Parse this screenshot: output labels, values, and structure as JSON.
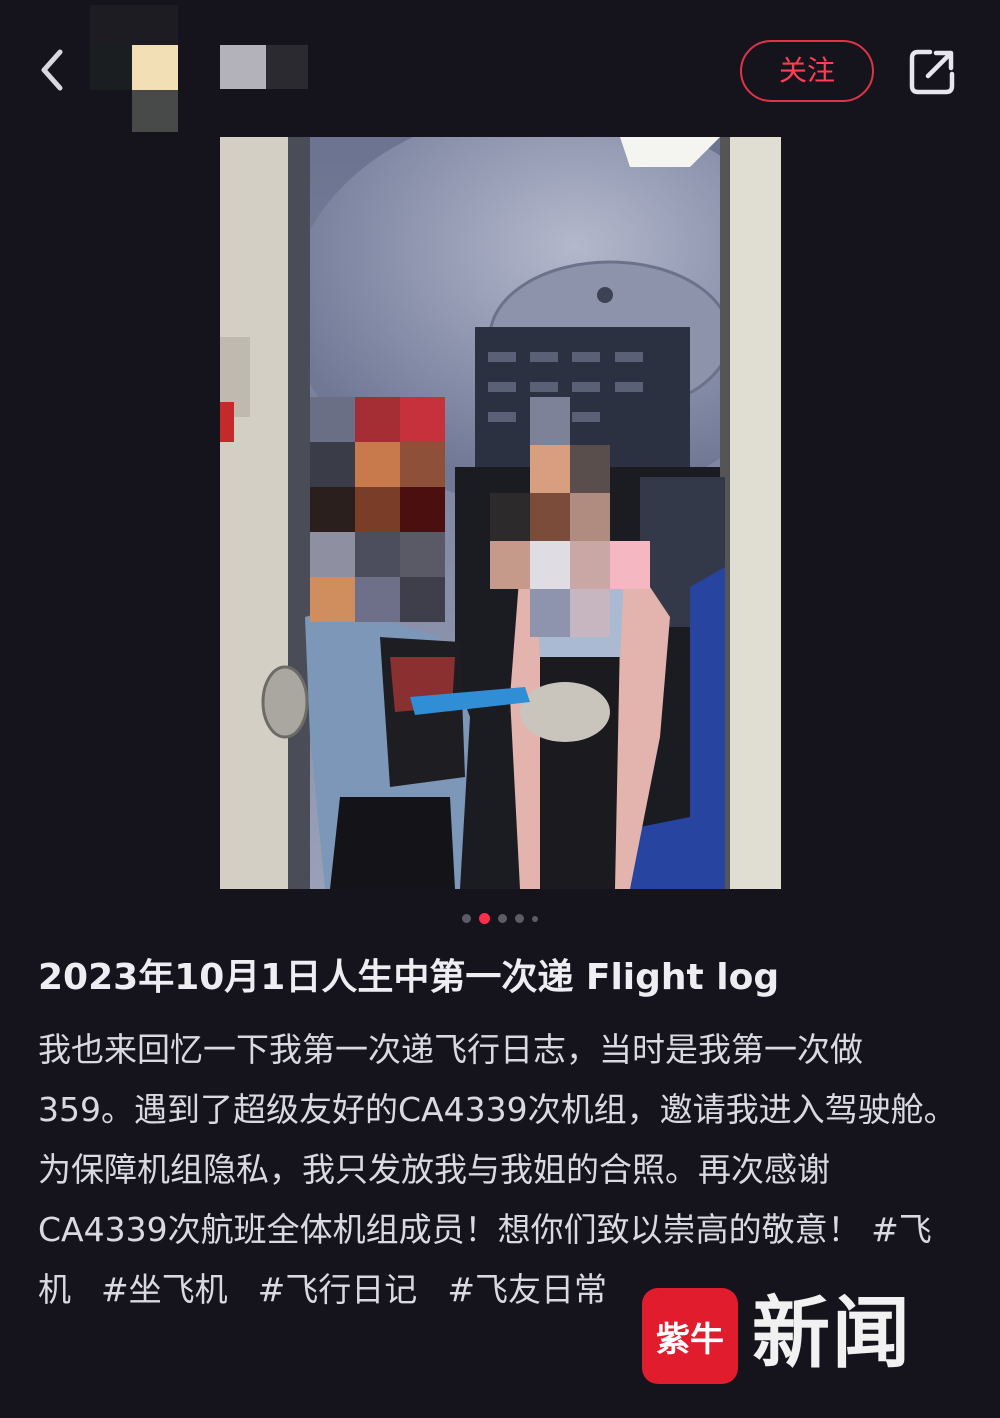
{
  "header": {
    "follow_label": "关注"
  },
  "icons": {
    "back": "chevron-left-icon",
    "share": "share-external-icon"
  },
  "gallery": {
    "total": 5,
    "active_index": 1
  },
  "post": {
    "title": "2023年10月1日人生中第一次递 Flight log",
    "body": "我也来回忆一下我第一次递飞行日志，当时是我第一次做359。遇到了超级友好的CA4339次机组，邀请我进入驾驶舱。为保障机组隐私，我只发放我与我姐的合照。再次感谢CA4339次航班全体机组成员！想你们致以崇高的敬意！",
    "tags": [
      "#飞机",
      "#坐飞机",
      "#飞行日记",
      "#飞友日常"
    ]
  },
  "watermark": {
    "logo_text": "紫牛",
    "name": "新闻"
  },
  "colors": {
    "background": "#15141c",
    "accent": "#ff3d55",
    "text": "#d9d9e0"
  }
}
